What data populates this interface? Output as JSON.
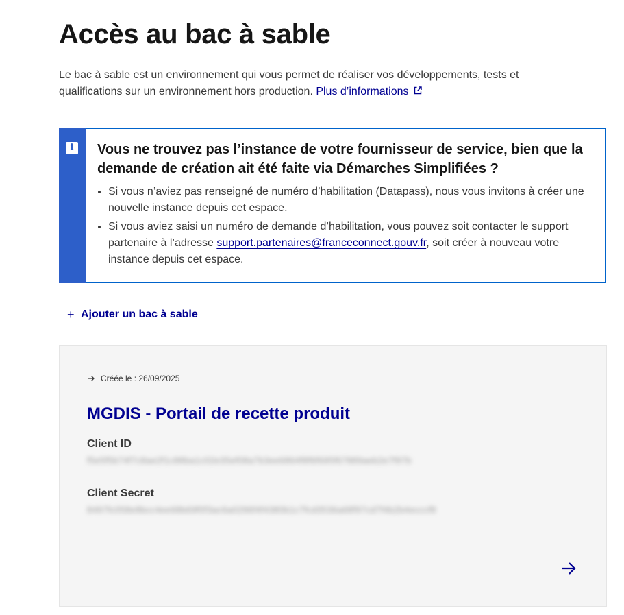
{
  "page": {
    "title": "Accès au bac à sable",
    "intro_text": "Le bac à sable est un environnement qui vous permet de réaliser vos développements, tests et qualifications sur un environnement hors production. ",
    "intro_link": "Plus d’informations"
  },
  "notice": {
    "title": "Vous ne trouvez pas l’instance de votre fournisseur de service, bien que la demande de création ait été faite via Démarches Simplifiées ?",
    "item1": "Si vous n’aviez pas renseigné de numéro d’habilitation (Datapass), nous vous invitons à créer une nouvelle instance depuis cet espace.",
    "item2_before": "Si vous aviez saisi un numéro de demande d’habilitation, vous pouvez soit contacter le support partenaire à l’adresse ",
    "item2_link": "support.partenaires@franceconnect.gouv.fr",
    "item2_after": ", soit créer à nouveau votre instance depuis cet espace.",
    "icon": "info-icon"
  },
  "actions": {
    "add_sandbox": "Ajouter un bac à sable"
  },
  "card": {
    "date": "Créée le : 26/09/2025",
    "title": "MGDIS - Portail de recette produit",
    "client_id_label": "Client ID",
    "client_id_value": "f5e5f5b74f7c8ae2f1c88ba1c02e35ef08a7b3ee6864f8f6f695f67889aeb2e7f97b",
    "client_secret_label": "Client Secret",
    "client_secret_value": "8497fc058e8bcc4ee68b69f0f3ac6a0296f4f4380b1c7fcd3536a68f97cd7f4b2b4ecccf8"
  },
  "colors": {
    "accent": "#000091",
    "notice_blue": "#2d5fc9",
    "card_bg": "#f5f5f5"
  }
}
